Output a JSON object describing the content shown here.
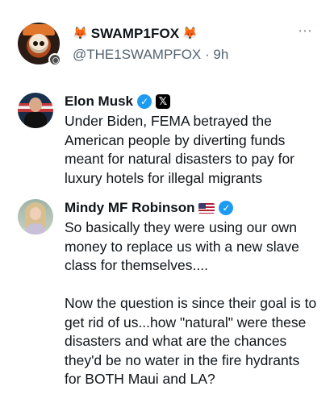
{
  "post": {
    "display_name": "SWAMP1FOX",
    "fox_emoji_left": "🦊",
    "fox_emoji_right": "🦊",
    "handle_time": "@THE1SWAMPFOX · 9h",
    "more_icon": "⋯"
  },
  "quotes": [
    {
      "name": "Elon Musk",
      "verified": true,
      "affiliate_badge": "𝕏",
      "text": "Under Biden, FEMA betrayed the American people by diverting funds meant for natural disasters to pay for luxury hotels for illegal migrants"
    },
    {
      "name": "Mindy MF Robinson",
      "flag": "us-flag",
      "verified": true,
      "text": "So basically they were using our own money to replace us with a new slave class for themselves....\n\nNow the question is since their goal is to get rid of us...how \"natural\" were these disasters and what are the chances they'd be no water in the fire hydrants for BOTH Maui and LA?"
    }
  ],
  "colors": {
    "verified": "#1d9bf0",
    "secondary_text": "#536471",
    "text": "#0f1419"
  }
}
